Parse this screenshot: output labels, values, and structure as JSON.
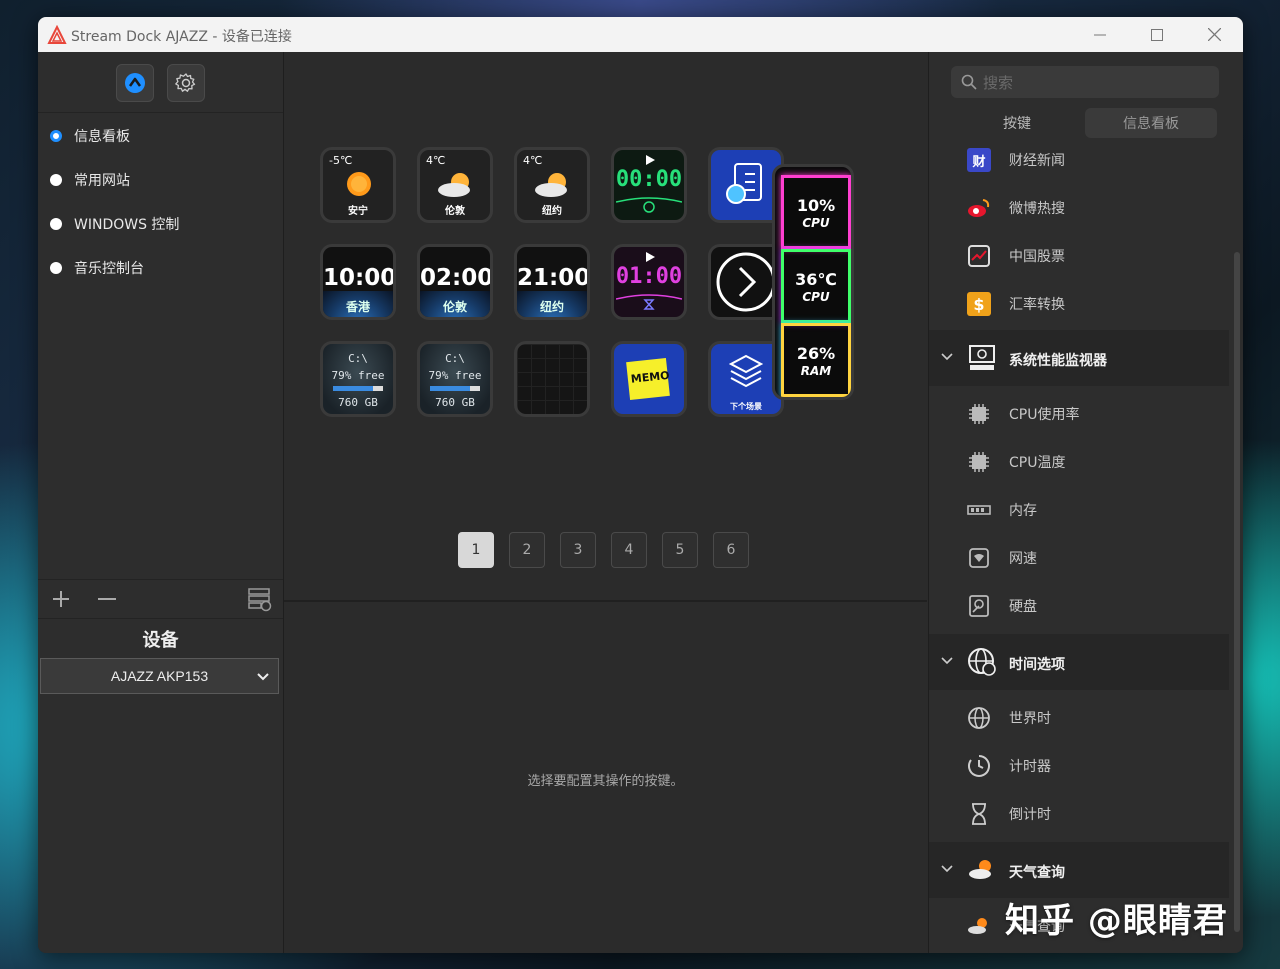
{
  "window": {
    "title": "Stream Dock AJAZZ - 设备已连接"
  },
  "sidebar": {
    "profiles": [
      {
        "label": "信息看板",
        "active": true
      },
      {
        "label": "常用网站",
        "active": false
      },
      {
        "label": "WINDOWS 控制",
        "active": false
      },
      {
        "label": "音乐控制台",
        "active": false
      }
    ],
    "device_title": "设备",
    "device_selected": "AJAZZ AKP153"
  },
  "keys": {
    "weather": [
      {
        "temp": "-5℃",
        "city": "安宁"
      },
      {
        "temp": "4℃",
        "city": "伦敦"
      },
      {
        "temp": "4℃",
        "city": "纽约"
      }
    ],
    "timer1": "00:00",
    "clocks": [
      {
        "time": "10:00",
        "city": "香港"
      },
      {
        "time": "02:00",
        "city": "伦敦"
      },
      {
        "time": "21:00",
        "city": "纽约"
      }
    ],
    "timer2": "01:00",
    "disks": [
      {
        "drive": "C:\\",
        "free": "79% free",
        "size": "760 GB"
      },
      {
        "drive": "C:\\",
        "free": "79% free",
        "size": "760 GB"
      }
    ],
    "memo": "MEMO",
    "next_scene": "下个场景",
    "monitors": [
      {
        "value": "10%",
        "label": "CPU"
      },
      {
        "value": "36℃",
        "label": "CPU"
      },
      {
        "value": "26%",
        "label": "RAM"
      }
    ]
  },
  "pager": {
    "pages": [
      "1",
      "2",
      "3",
      "4",
      "5",
      "6"
    ],
    "active": "1"
  },
  "hint": "选择要配置其操作的按键。",
  "right": {
    "search_placeholder": "搜索",
    "tabs": [
      "按键",
      "信息看板"
    ],
    "items": {
      "finance_news": "财经新闻",
      "weibo": "微博热搜",
      "cn_stock": "中国股票",
      "fx": "汇率转换",
      "cat_sys": "系统性能监视器",
      "cpu_usage": "CPU使用率",
      "cpu_temp": "CPU温度",
      "memory": "内存",
      "netspeed": "网速",
      "disk": "硬盘",
      "cat_time": "时间选项",
      "worldtime": "世界时",
      "timer": "计时器",
      "countdown": "倒计时",
      "cat_weather": "天气查询",
      "weather_query": "天气查询"
    }
  },
  "watermark": "知乎 @眼睛君",
  "colors": {
    "accent": "#1f8fff",
    "bg": "#2b2b2b",
    "panel": "#2d2d2d"
  }
}
